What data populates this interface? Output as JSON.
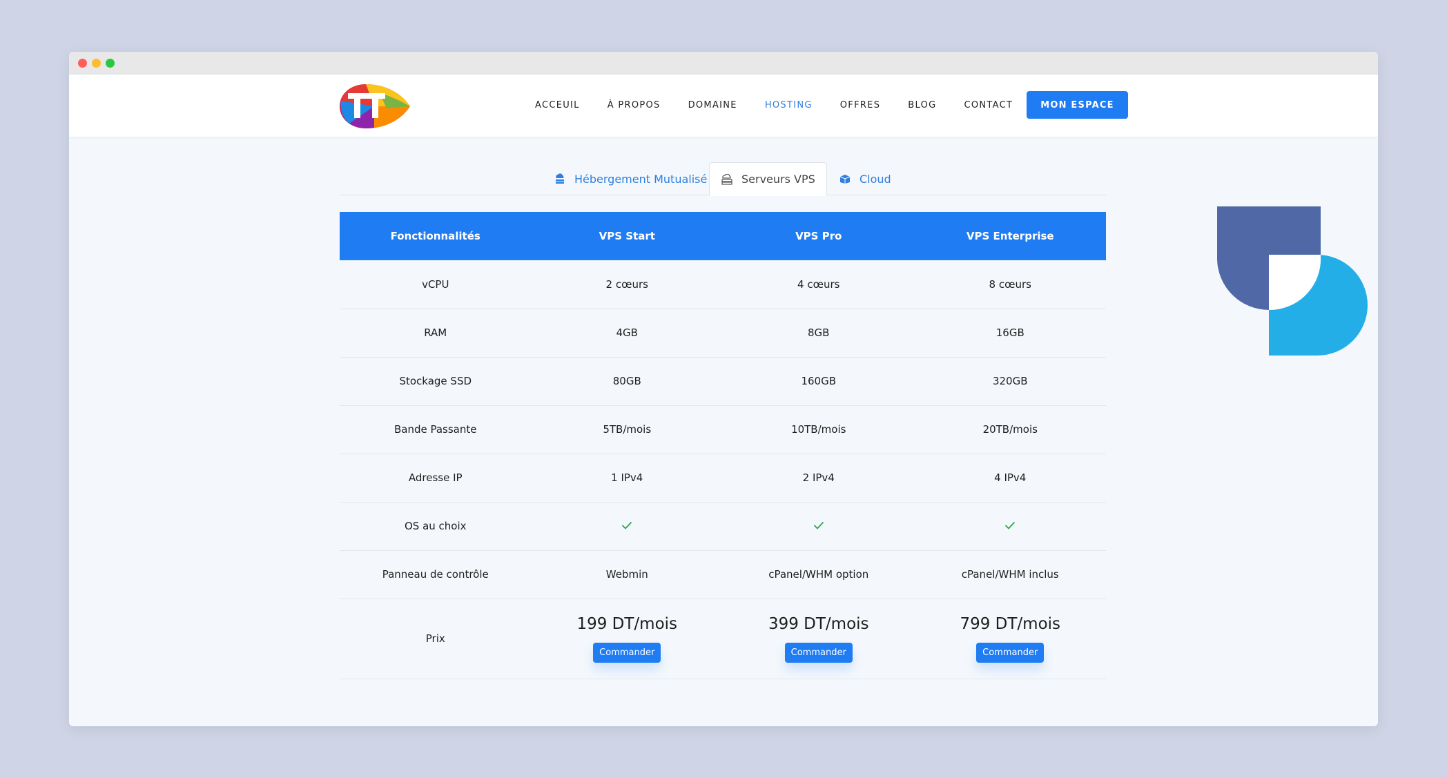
{
  "nav": {
    "items": [
      {
        "label": "ACCEUIL",
        "active": false
      },
      {
        "label": "À PROPOS",
        "active": false
      },
      {
        "label": "DOMAINE",
        "active": false
      },
      {
        "label": "HOSTING",
        "active": true
      },
      {
        "label": "OFFRES",
        "active": false
      },
      {
        "label": "BLOG",
        "active": false
      },
      {
        "label": "CONTACT",
        "active": false
      }
    ],
    "cta_label": "MON ESPACE"
  },
  "tabs": [
    {
      "label": "Hébergement Mutualisé",
      "icon": "cloud-server-icon",
      "active": false
    },
    {
      "label": "Serveurs VPS",
      "icon": "server-icon",
      "active": true
    },
    {
      "label": "Cloud",
      "icon": "cloud-box-icon",
      "active": false
    }
  ],
  "table": {
    "headers": [
      "Fonctionnalités",
      "VPS Start",
      "VPS Pro",
      "VPS Enterprise"
    ],
    "rows": [
      {
        "feature": "vCPU",
        "values": [
          "2 cœurs",
          "4 cœurs",
          "8 cœurs"
        ]
      },
      {
        "feature": "RAM",
        "values": [
          "4GB",
          "8GB",
          "16GB"
        ]
      },
      {
        "feature": "Stockage SSD",
        "values": [
          "80GB",
          "160GB",
          "320GB"
        ]
      },
      {
        "feature": "Bande Passante",
        "values": [
          "5TB/mois",
          "10TB/mois",
          "20TB/mois"
        ]
      },
      {
        "feature": "Adresse IP",
        "values": [
          "1 IPv4",
          "2 IPv4",
          "4 IPv4"
        ]
      },
      {
        "feature": "OS au choix",
        "values": [
          "check-icon",
          "check-icon",
          "check-icon"
        ]
      },
      {
        "feature": "Panneau de contrôle",
        "values": [
          "Webmin",
          "cPanel/WHM option",
          "cPanel/WHM inclus"
        ]
      }
    ],
    "price": {
      "feature": "Prix",
      "values": [
        "199 DT/mois",
        "399 DT/mois",
        "799 DT/mois"
      ],
      "button_label": "Commander"
    }
  },
  "colors": {
    "accent": "#1f7cf2",
    "active_nav": "#2d7fe0",
    "check": "#28a745",
    "deco_dark": "#5069a6",
    "deco_light": "#24aee8"
  }
}
